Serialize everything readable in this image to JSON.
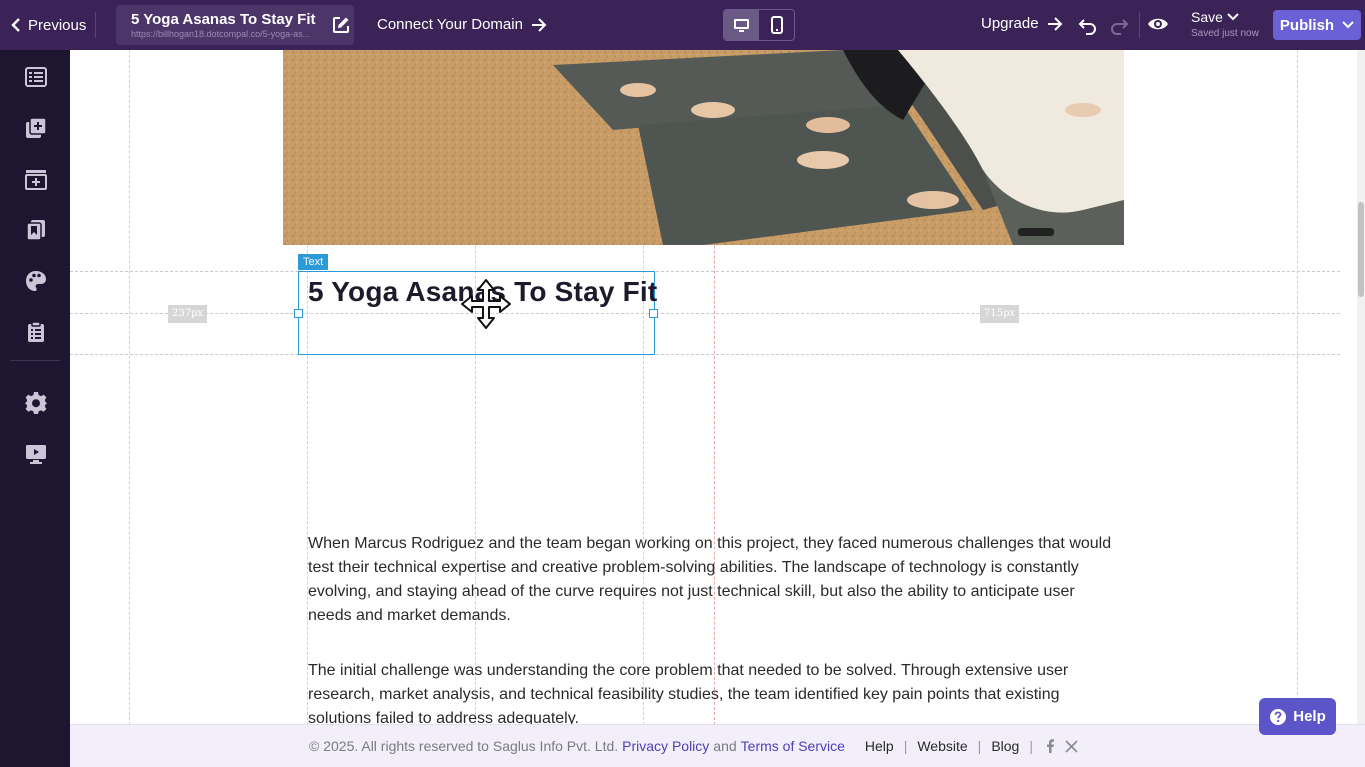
{
  "topbar": {
    "previous_label": "Previous",
    "page_title": "5 Yoga Asanas To Stay Fit",
    "page_url": "https://billhogan18.dotcompal.co/5-yoga-as...",
    "connect_label": "Connect Your Domain",
    "upgrade_label": "Upgrade",
    "save_label": "Save",
    "save_status": "Saved just now",
    "publish_label": "Publish",
    "active_device": "desktop"
  },
  "sidebar": {
    "items": [
      {
        "icon": "list-icon"
      },
      {
        "icon": "add-page-icon"
      },
      {
        "icon": "section-icon"
      },
      {
        "icon": "bookmark-icon"
      },
      {
        "icon": "palette-icon"
      },
      {
        "icon": "clipboard-icon"
      },
      {
        "icon": "gear-icon"
      },
      {
        "icon": "presentation-icon"
      }
    ]
  },
  "canvas": {
    "selection_tag": "Text",
    "left_spacing_tag": "237px",
    "right_spacing_tag": "715px",
    "heading": "5 Yoga Asanas To Stay Fit",
    "paragraph_1": "When Marcus Rodriguez and the team began working on this project, they faced numerous challenges that would test their technical expertise and creative problem-solving abilities. The landscape of technology is constantly evolving, and staying ahead of the curve requires not just technical skill, but also the ability to anticipate user needs and market demands.",
    "paragraph_2": "The initial challenge was understanding the core problem that needed to be solved. Through extensive user research, market analysis, and technical feasibility studies, the team identified key pain points that existing solutions failed to address adequately."
  },
  "footer": {
    "copyright": "©  2025. All rights reserved to Saglus Info Pvt. Ltd.",
    "privacy": "Privacy Policy",
    "and": "and",
    "terms": "Terms of Service",
    "help": "Help",
    "website": "Website",
    "blog": "Blog",
    "pipe": "|"
  },
  "help_button": {
    "label": "Help"
  },
  "colors": {
    "topbar": "#3b2357",
    "sidebar": "#1e1530",
    "publish": "#6b61d6",
    "selection": "#2c9ad6",
    "footer_link": "#4d3fb8"
  }
}
